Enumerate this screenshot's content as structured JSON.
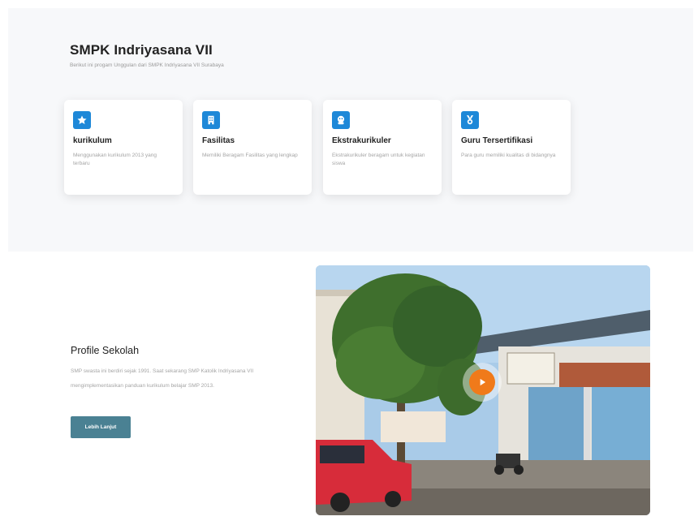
{
  "hero": {
    "title": "SMPK Indriyasana VII",
    "subtitle": "Berikut ini progam Unggulan dari SMPK Indriyasana VII Surabaya"
  },
  "features": [
    {
      "icon": "star-icon",
      "title": "kurikulum",
      "description": "Menggunakan kurikulum 2013 yang terbaru"
    },
    {
      "icon": "building-icon",
      "title": "Fasilitas",
      "description": "Memiliki Beragam Fasilitas yang lengkap"
    },
    {
      "icon": "activity-icon",
      "title": "Ekstrakurikuler",
      "description": "Ekstrakurikuler beragam untuk kegiatan siswa"
    },
    {
      "icon": "medal-icon",
      "title": "Guru Tersertifikasi",
      "description": "Para guru memiliki kualitas di bidangnya"
    }
  ],
  "profile": {
    "title": "Profile Sekolah",
    "description": "SMP swasta ini berdiri sejak 1991. Saat sekarang SMP Katolik Indriyasana VII mengimplementasikan panduan kurikulum belajar SMP 2013.",
    "button_label": "Lebih Lanjut"
  },
  "video": {
    "play_icon": "play-icon"
  },
  "colors": {
    "accent": "#1e88d8",
    "button": "#4a8193",
    "play": "#f07a1a",
    "hero_bg": "#f7f8fa"
  }
}
